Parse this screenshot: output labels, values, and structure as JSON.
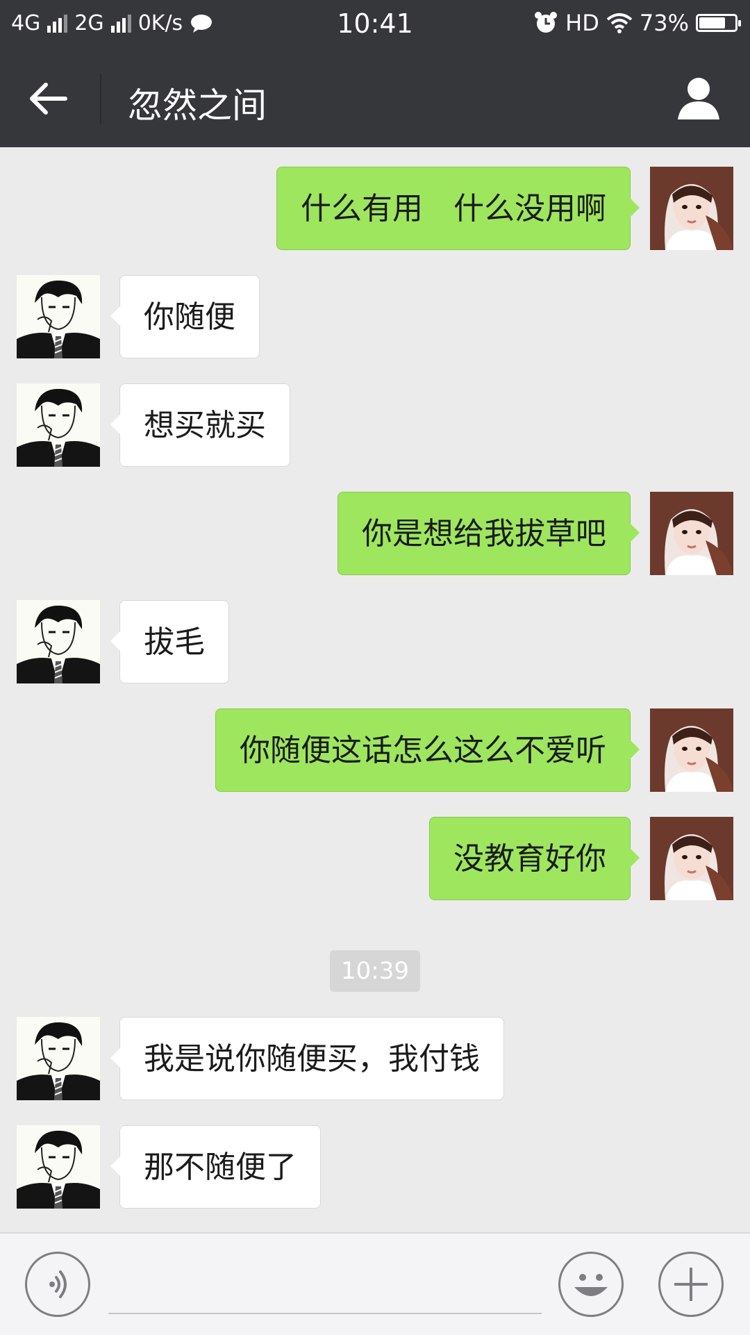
{
  "status_bar": {
    "network1": "4G",
    "network2": "2G",
    "speed": "0K/s",
    "time": "10:41",
    "hd": "HD",
    "battery_percent": "73%",
    "battery_level": 0.73,
    "icons": [
      "signal-icon",
      "chat-notification-icon",
      "alarm-icon",
      "wifi-icon",
      "battery-icon"
    ]
  },
  "header": {
    "title": "忽然之间",
    "back_icon": "back-arrow-icon",
    "profile_icon": "person-icon"
  },
  "messages": [
    {
      "side": "out",
      "text": "什么有用　什么没用啊"
    },
    {
      "side": "in",
      "text": "你随便"
    },
    {
      "side": "in",
      "text": "想买就买"
    },
    {
      "side": "out",
      "text": "你是想给我拔草吧"
    },
    {
      "side": "in",
      "text": "拔毛"
    },
    {
      "side": "out",
      "text": "你随便这话怎么这么不爱听"
    },
    {
      "side": "out",
      "text": "没教育好你"
    },
    {
      "side": "in",
      "text": "我是说你随便买，我付钱"
    },
    {
      "side": "in",
      "text": "那不随便了"
    }
  ],
  "timestamp": "10:39",
  "input_bar": {
    "input_value": "",
    "voice_icon": "voice-icon",
    "emoji_icon": "emoji-icon",
    "plus_icon": "plus-icon"
  },
  "colors": {
    "bar_bg": "#36373b",
    "chat_bg": "#ebebeb",
    "out_bubble": "#9ee65e",
    "in_bubble": "#ffffff"
  }
}
